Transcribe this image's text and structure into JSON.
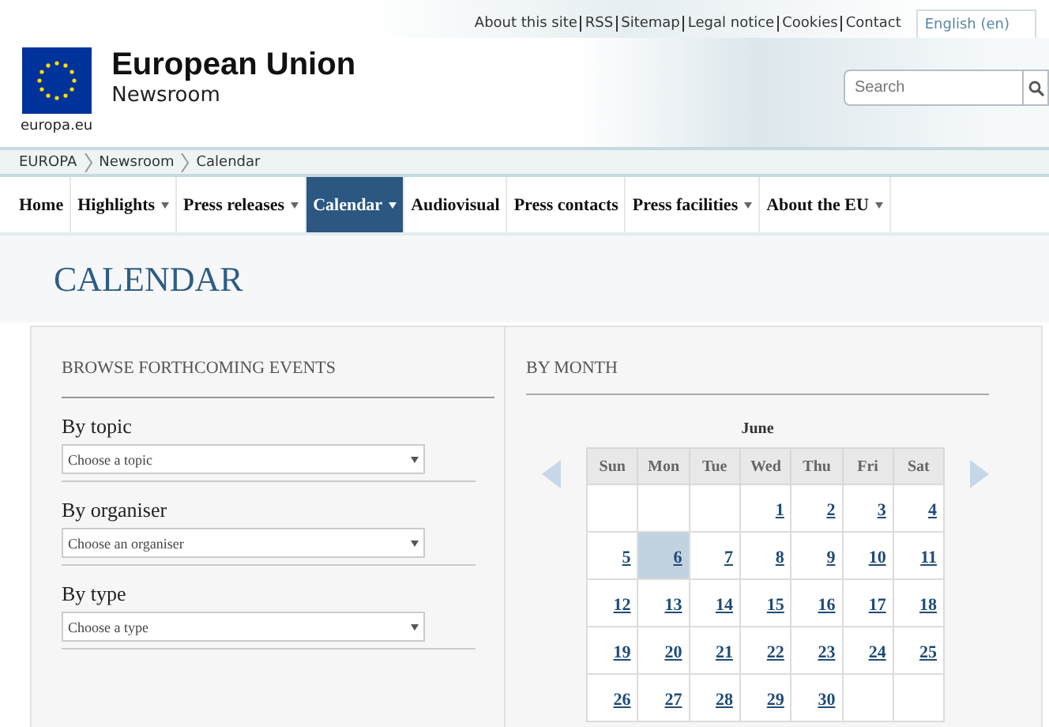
{
  "top_links": [
    "About this site",
    "RSS",
    "Sitemap",
    "Legal notice",
    "Cookies",
    "Contact"
  ],
  "language": "English (en)",
  "logo_caption": "europa.eu",
  "site_title": "European Union",
  "site_subtitle": "Newsroom",
  "search": {
    "placeholder": "Search"
  },
  "breadcrumb": [
    "EUROPA",
    "Newsroom",
    "Calendar"
  ],
  "nav": [
    {
      "label": "Home",
      "dropdown": false,
      "selected": false
    },
    {
      "label": "Highlights",
      "dropdown": true,
      "selected": false
    },
    {
      "label": "Press releases",
      "dropdown": true,
      "selected": false
    },
    {
      "label": "Calendar",
      "dropdown": true,
      "selected": true
    },
    {
      "label": "Audiovisual",
      "dropdown": false,
      "selected": false
    },
    {
      "label": "Press contacts",
      "dropdown": false,
      "selected": false
    },
    {
      "label": "Press facilities",
      "dropdown": true,
      "selected": false
    },
    {
      "label": "About the EU",
      "dropdown": true,
      "selected": false
    }
  ],
  "page_title": "CALENDAR",
  "browse": {
    "heading": "BROWSE FORTHCOMING EVENTS",
    "filters": [
      {
        "label": "By topic",
        "placeholder": "Choose a topic"
      },
      {
        "label": "By organiser",
        "placeholder": "Choose an organiser"
      },
      {
        "label": "By type",
        "placeholder": "Choose a type"
      }
    ]
  },
  "by_month": {
    "heading": "BY MONTH",
    "month": "June",
    "weekdays": [
      "Sun",
      "Mon",
      "Tue",
      "Wed",
      "Thu",
      "Fri",
      "Sat"
    ],
    "weeks": [
      [
        {
          "kind": "empty"
        },
        {
          "kind": "empty"
        },
        {
          "kind": "empty"
        },
        {
          "kind": "day",
          "day": "1",
          "selected": false
        },
        {
          "kind": "day",
          "day": "2",
          "selected": false
        },
        {
          "kind": "day",
          "day": "3",
          "selected": false
        },
        {
          "kind": "day",
          "day": "4",
          "selected": false
        }
      ],
      [
        {
          "kind": "day",
          "day": "5",
          "selected": false
        },
        {
          "kind": "day",
          "day": "6",
          "selected": true
        },
        {
          "kind": "day",
          "day": "7",
          "selected": false
        },
        {
          "kind": "day",
          "day": "8",
          "selected": false
        },
        {
          "kind": "day",
          "day": "9",
          "selected": false
        },
        {
          "kind": "day",
          "day": "10",
          "selected": false
        },
        {
          "kind": "day",
          "day": "11",
          "selected": false
        }
      ],
      [
        {
          "kind": "day",
          "day": "12",
          "selected": false
        },
        {
          "kind": "day",
          "day": "13",
          "selected": false
        },
        {
          "kind": "day",
          "day": "14",
          "selected": false
        },
        {
          "kind": "day",
          "day": "15",
          "selected": false
        },
        {
          "kind": "day",
          "day": "16",
          "selected": false
        },
        {
          "kind": "day",
          "day": "17",
          "selected": false
        },
        {
          "kind": "day",
          "day": "18",
          "selected": false
        }
      ],
      [
        {
          "kind": "day",
          "day": "19",
          "selected": false
        },
        {
          "kind": "day",
          "day": "20",
          "selected": false
        },
        {
          "kind": "day",
          "day": "21",
          "selected": false
        },
        {
          "kind": "day",
          "day": "22",
          "selected": false
        },
        {
          "kind": "day",
          "day": "23",
          "selected": false
        },
        {
          "kind": "day",
          "day": "24",
          "selected": false
        },
        {
          "kind": "day",
          "day": "25",
          "selected": false
        }
      ],
      [
        {
          "kind": "day",
          "day": "26",
          "selected": false
        },
        {
          "kind": "day",
          "day": "27",
          "selected": false
        },
        {
          "kind": "day",
          "day": "28",
          "selected": false
        },
        {
          "kind": "day",
          "day": "29",
          "selected": false
        },
        {
          "kind": "day",
          "day": "30",
          "selected": false
        },
        {
          "kind": "empty"
        },
        {
          "kind": "empty"
        }
      ]
    ]
  }
}
